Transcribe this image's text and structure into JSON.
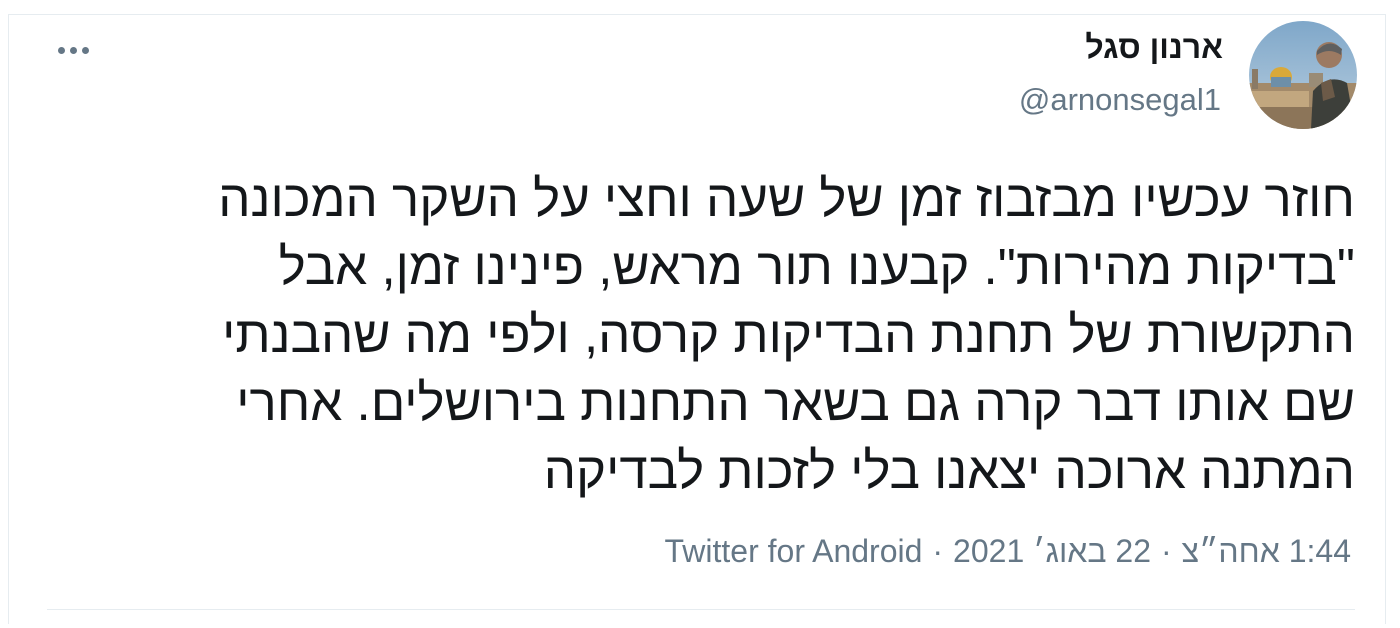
{
  "author": {
    "display_name": "ארנון סגל",
    "handle": "@arnonsegal1"
  },
  "tweet": {
    "lines": [
      "חוזר עכשיו מבזבוז זמן של שעה וחצי על השקר המכונה",
      "\"בדיקות מהירות\". קבענו תור מראש, פינינו זמן, אבל",
      "התקשורת של תחנת הבדיקות קרסה, ולפי מה שהבנתי",
      "שם אותו דבר קרה גם בשאר התחנות בירושלים. אחרי",
      "המתנה ארוכה יצאנו בלי לזכות לבדיקה"
    ]
  },
  "meta": {
    "time": "1:44 אחה״צ",
    "date": "22 באוג׳ 2021",
    "source": "Twitter for Android",
    "separator": "·"
  },
  "icons": {
    "more": "more-horizontal-icon",
    "avatar": "profile-photo"
  },
  "colors": {
    "primary_text": "#14171a",
    "secondary_text": "#657786",
    "border": "#e6ecf0"
  }
}
